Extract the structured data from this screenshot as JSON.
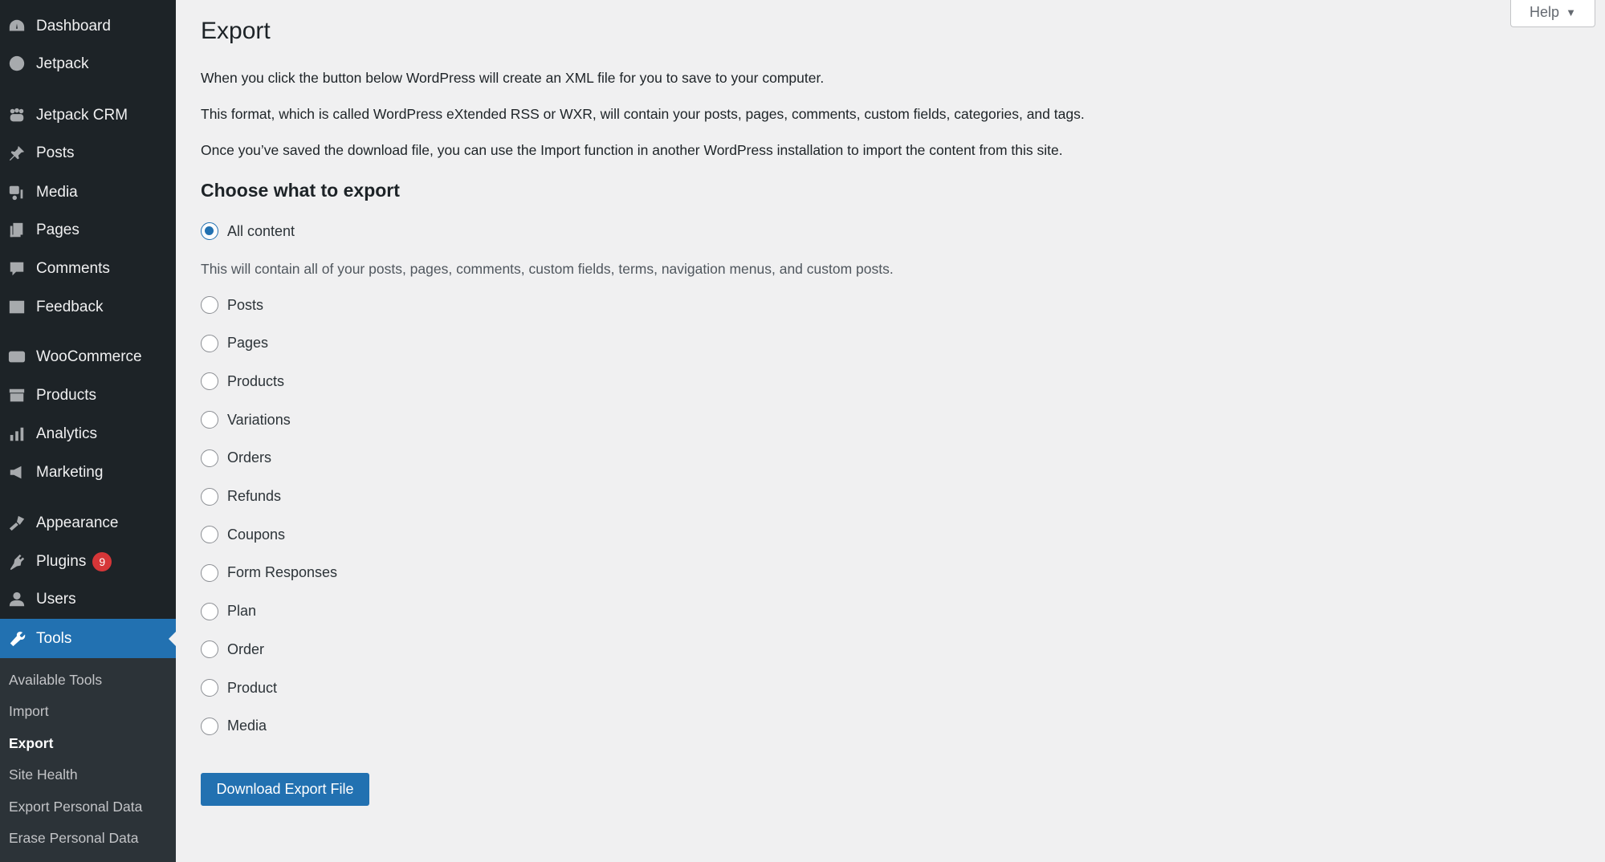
{
  "sidebar": {
    "items": [
      {
        "label": "Dashboard",
        "icon": "dashboard-icon"
      },
      {
        "label": "Jetpack",
        "icon": "jetpack-icon"
      },
      {
        "label": "Jetpack CRM",
        "icon": "crm-icon"
      },
      {
        "label": "Posts",
        "icon": "pin-icon"
      },
      {
        "label": "Media",
        "icon": "media-icon"
      },
      {
        "label": "Pages",
        "icon": "pages-icon"
      },
      {
        "label": "Comments",
        "icon": "comment-icon"
      },
      {
        "label": "Feedback",
        "icon": "feedback-icon"
      },
      {
        "label": "WooCommerce",
        "icon": "woo-icon"
      },
      {
        "label": "Products",
        "icon": "archive-icon"
      },
      {
        "label": "Analytics",
        "icon": "bar-chart-icon"
      },
      {
        "label": "Marketing",
        "icon": "megaphone-icon"
      },
      {
        "label": "Appearance",
        "icon": "brush-icon"
      },
      {
        "label": "Plugins",
        "icon": "plug-icon",
        "badge": "9"
      },
      {
        "label": "Users",
        "icon": "user-icon"
      },
      {
        "label": "Tools",
        "icon": "wrench-icon",
        "active": true
      }
    ],
    "submenu": [
      "Available Tools",
      "Import",
      "Export",
      "Site Health",
      "Export Personal Data",
      "Erase Personal Data"
    ],
    "current_submenu": "Export"
  },
  "help": {
    "label": "Help"
  },
  "main": {
    "title": "Export",
    "paragraphs": [
      "When you click the button below WordPress will create an XML file for you to save to your computer.",
      "This format, which is called WordPress eXtended RSS or WXR, will contain your posts, pages, comments, custom fields, categories, and tags.",
      "Once you’ve saved the download file, you can use the Import function in another WordPress installation to import the content from this site."
    ],
    "choose_heading": "Choose what to export",
    "all_content": "All content",
    "all_content_desc": "This will contain all of your posts, pages, comments, custom fields, terms, navigation menus, and custom posts.",
    "options": [
      "Posts",
      "Pages",
      "Products",
      "Variations",
      "Orders",
      "Refunds",
      "Coupons",
      "Form Responses",
      "Plan",
      "Order",
      "Product",
      "Media"
    ],
    "selected": "All content",
    "download_button": "Download Export File"
  },
  "colors": {
    "accent": "#2271b1",
    "sidebar": "#1d2327",
    "badge": "#d63638"
  }
}
